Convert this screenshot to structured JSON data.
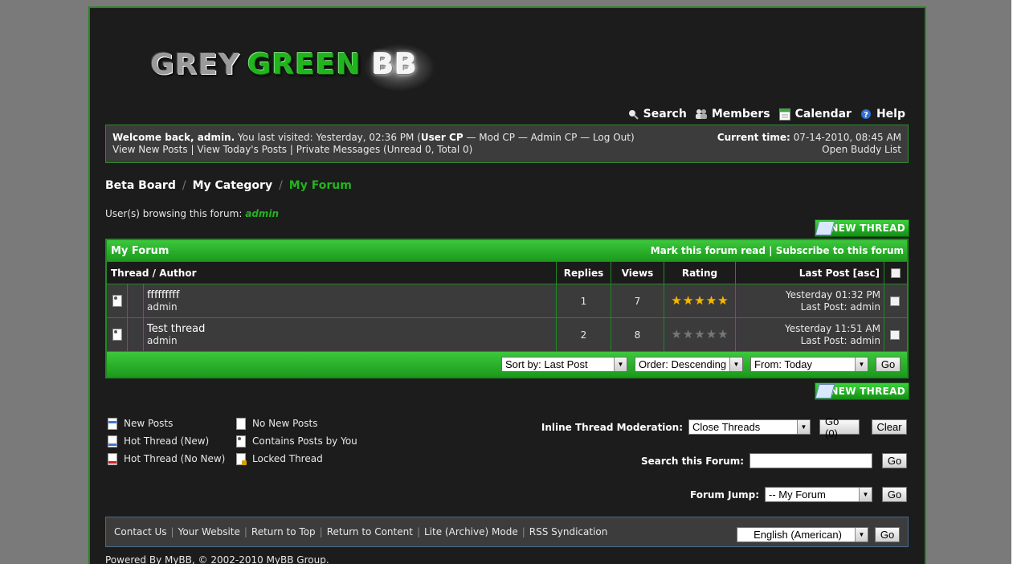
{
  "logo": {
    "part1": "GREY",
    "part2": "GREEN",
    "part3": "BB"
  },
  "top_menu": [
    {
      "icon": "search-icon",
      "label": "Search"
    },
    {
      "icon": "members-icon",
      "label": "Members"
    },
    {
      "icon": "calendar-icon",
      "label": "Calendar"
    },
    {
      "icon": "help-icon",
      "label": "Help"
    }
  ],
  "panel": {
    "welcome_bold": "Welcome back, admin.",
    "last_visited": " You last visited: Yesterday, 02:36 PM (",
    "user_cp": "User CP",
    "mod_cp": " — Mod CP",
    "admin_cp": " — Admin CP",
    "logout": " — Log Out",
    "close_paren": ")",
    "view_new_posts": "View New Posts",
    "view_today": "View Today's Posts",
    "private_messages": "Private Messages (Unread 0, Total 0)",
    "sep": " | ",
    "current_time_label": "Current time:",
    "current_time_value": " 07-14-2010, 08:45 AM",
    "buddy_list": "Open Buddy List"
  },
  "breadcrumb": {
    "board": "Beta Board",
    "category": "My Category",
    "forum": "My Forum",
    "sep": "/"
  },
  "browsing": {
    "label": "User(s) browsing this forum: ",
    "user": "admin"
  },
  "new_thread_label": "NEW THREAD",
  "forum": {
    "title": "My Forum",
    "mark_read": "Mark this forum read",
    "link_sep": " | ",
    "subscribe": "Subscribe to this forum",
    "columns": {
      "thread": "Thread / Author",
      "replies": "Replies",
      "views": "Views",
      "rating": "Rating",
      "last_post": "Last Post [asc]"
    },
    "threads": [
      {
        "title": "fffffffff",
        "author": "admin",
        "replies": "1",
        "views": "7",
        "rating": 5,
        "last_date": "Yesterday 01:32 PM",
        "last_by": "Last Post: admin"
      },
      {
        "title": "Test thread",
        "author": "admin",
        "replies": "2",
        "views": "8",
        "rating": 0,
        "last_date": "Yesterday 11:51 AM",
        "last_by": "Last Post: admin"
      }
    ],
    "sort_by": "Sort by: Last Post",
    "order": "Order: Descending",
    "from": "From: Today",
    "go": "Go"
  },
  "legend": [
    {
      "icon": "new-posts-icon",
      "label": "New Posts",
      "cls": "new"
    },
    {
      "icon": "no-new-posts-icon",
      "label": "No New Posts",
      "cls": ""
    },
    {
      "icon": "hot-thread-new-icon",
      "label": "Hot Thread (New)",
      "cls": "hot"
    },
    {
      "icon": "contains-posts-icon",
      "label": "Contains Posts by You",
      "cls": "posts"
    },
    {
      "icon": "hot-thread-no-new-icon",
      "label": "Hot Thread (No New)",
      "cls": "hotnonew"
    },
    {
      "icon": "locked-thread-icon",
      "label": "Locked Thread",
      "cls": "locked"
    }
  ],
  "moderation": {
    "label": "Inline Thread Moderation:",
    "action": "Close Threads",
    "go": "Go (0)",
    "clear": "Clear"
  },
  "search_forum": {
    "label": "Search this Forum:",
    "value": "",
    "go": "Go"
  },
  "forum_jump": {
    "label": "Forum Jump:",
    "value": "-- My Forum",
    "go": "Go"
  },
  "footer": {
    "links": [
      "Contact Us",
      "Your Website",
      "Return to Top",
      "Return to Content",
      "Lite (Archive) Mode",
      "RSS Syndication"
    ],
    "language": "English (American)",
    "go": "Go"
  },
  "powered": "Powered By MyBB, © 2002-2010 MyBB Group."
}
